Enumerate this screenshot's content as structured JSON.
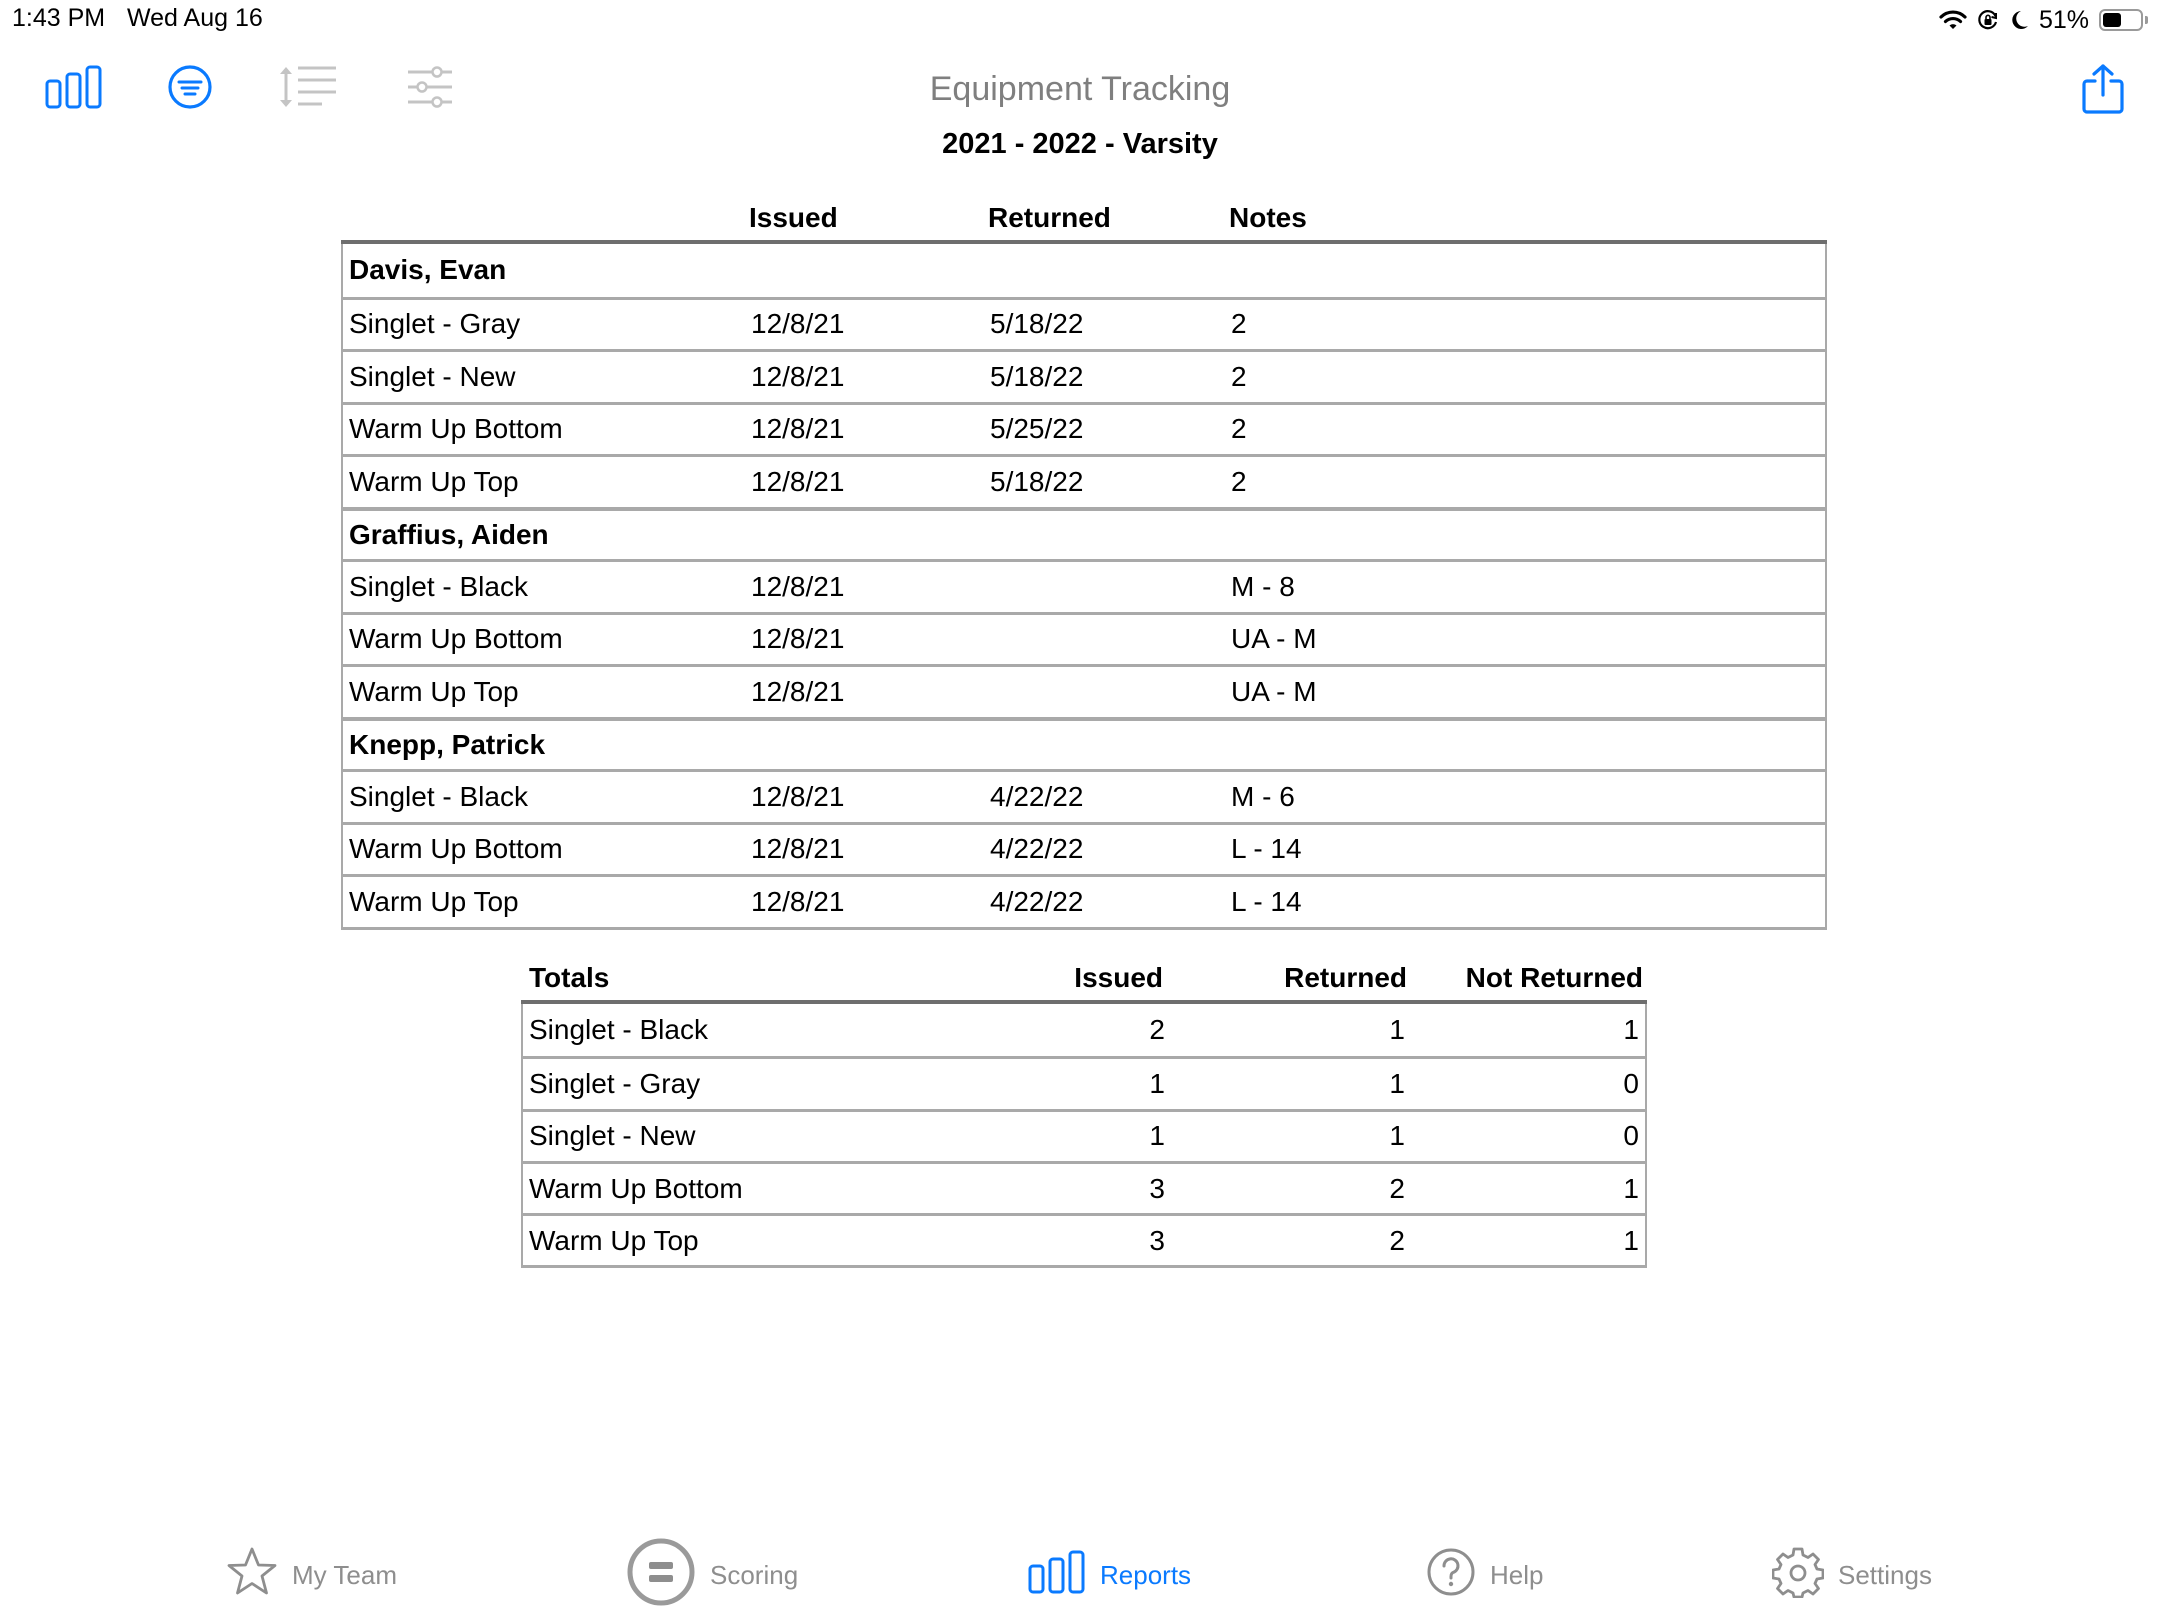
{
  "status_bar": {
    "time": "1:43 PM",
    "date": "Wed Aug 16",
    "battery_percent": "51%",
    "battery_level": 0.51,
    "icons": [
      "wifi-icon",
      "orientation-lock-icon",
      "do-not-disturb-moon-icon",
      "battery-icon"
    ]
  },
  "toolbar": {
    "left_icons": [
      "bar-chart-icon",
      "filter-icon",
      "line-spacing-icon",
      "sliders-icon"
    ],
    "right_icons": [
      "share-icon"
    ]
  },
  "header": {
    "title": "Equipment Tracking",
    "subtitle": "2021 - 2022 - Varsity"
  },
  "main_table": {
    "columns": {
      "item": "",
      "issued": "Issued",
      "returned": "Returned",
      "notes": "Notes"
    },
    "groups": [
      {
        "name": "Davis, Evan",
        "rows": [
          {
            "item": "Singlet - Gray",
            "issued": "12/8/21",
            "returned": "5/18/22",
            "notes": "2"
          },
          {
            "item": "Singlet - New",
            "issued": "12/8/21",
            "returned": "5/18/22",
            "notes": "2"
          },
          {
            "item": "Warm Up Bottom",
            "issued": "12/8/21",
            "returned": "5/25/22",
            "notes": "2"
          },
          {
            "item": "Warm Up Top",
            "issued": "12/8/21",
            "returned": "5/18/22",
            "notes": "2"
          }
        ]
      },
      {
        "name": "Graffius, Aiden",
        "rows": [
          {
            "item": "Singlet - Black",
            "issued": "12/8/21",
            "returned": "",
            "notes": "M - 8"
          },
          {
            "item": "Warm Up Bottom",
            "issued": "12/8/21",
            "returned": "",
            "notes": "UA - M"
          },
          {
            "item": "Warm Up Top",
            "issued": "12/8/21",
            "returned": "",
            "notes": "UA - M"
          }
        ]
      },
      {
        "name": "Knepp, Patrick",
        "rows": [
          {
            "item": "Singlet - Black",
            "issued": "12/8/21",
            "returned": "4/22/22",
            "notes": "M - 6"
          },
          {
            "item": "Warm Up Bottom",
            "issued": "12/8/21",
            "returned": "4/22/22",
            "notes": "L - 14"
          },
          {
            "item": "Warm Up Top",
            "issued": "12/8/21",
            "returned": "4/22/22",
            "notes": "L - 14"
          }
        ]
      }
    ]
  },
  "totals_table": {
    "columns": {
      "item": "Totals",
      "issued": "Issued",
      "returned": "Returned",
      "not_returned": "Not Returned"
    },
    "rows": [
      {
        "item": "Singlet - Black",
        "issued": "2",
        "returned": "1",
        "not_returned": "1"
      },
      {
        "item": "Singlet - Gray",
        "issued": "1",
        "returned": "1",
        "not_returned": "0"
      },
      {
        "item": "Singlet - New",
        "issued": "1",
        "returned": "1",
        "not_returned": "0"
      },
      {
        "item": "Warm Up Bottom",
        "issued": "3",
        "returned": "2",
        "not_returned": "1"
      },
      {
        "item": "Warm Up Top",
        "issued": "3",
        "returned": "2",
        "not_returned": "1"
      }
    ]
  },
  "tab_bar": {
    "active": "Reports",
    "accent_color": "#0a7aff",
    "inactive_color": "#8e8e8e",
    "tabs": [
      {
        "label": "My Team",
        "icon": "star-icon"
      },
      {
        "label": "Scoring",
        "icon": "scoring-icon"
      },
      {
        "label": "Reports",
        "icon": "bar-chart-icon"
      },
      {
        "label": "Help",
        "icon": "help-icon"
      },
      {
        "label": "Settings",
        "icon": "gear-icon"
      }
    ]
  }
}
